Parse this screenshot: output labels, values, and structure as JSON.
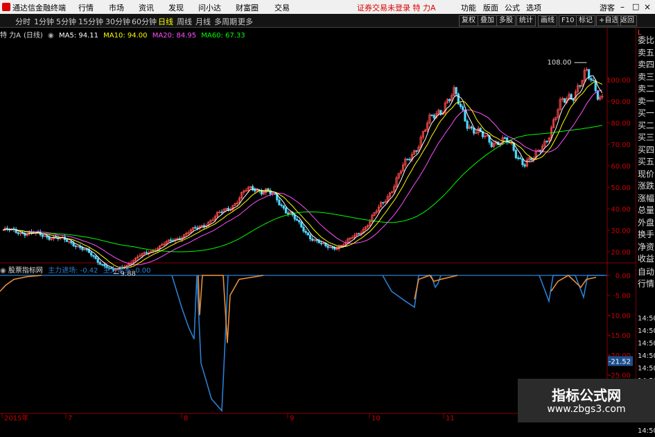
{
  "menubar": {
    "app_title": "通达信金融终端",
    "menus": [
      "行情",
      "市场",
      "资讯",
      "发现",
      "问小达",
      "财富圈",
      "交易"
    ],
    "notice": "证券交易未登录  特 力A",
    "right_menus": [
      "功能",
      "版面",
      "公式",
      "选项"
    ],
    "user": "游客"
  },
  "toolbar": {
    "periods": [
      "分时",
      "1分钟",
      "5分钟",
      "15分钟",
      "30分钟",
      "60分钟",
      "日线",
      "周线",
      "月线",
      "多周期",
      "更多"
    ],
    "active_period": "日线",
    "buttons": [
      "复权",
      "叠加",
      "多股",
      "统计",
      "画线",
      "F10",
      "标记",
      "+自选",
      "返回"
    ]
  },
  "info": {
    "stock": "特 力A",
    "period": "(日线)",
    "ma5": "MA5: 94.11",
    "ma10": "MA10: 94.00",
    "ma20": "MA20: 84.95",
    "ma60": "MA60: 67.33",
    "colors": {
      "ma5": "#ffffff",
      "ma10": "#ffff00",
      "ma20": "#ff50ff",
      "ma60": "#00ff00"
    }
  },
  "price_axis": {
    "ticks": [
      "100.00",
      "90.00",
      "80.00",
      "70.00",
      "60.00",
      "50.00",
      "40.00",
      "30.00",
      "20.00"
    ],
    "high_label": "108.00",
    "low_label": "9.88"
  },
  "sub_indicator": {
    "name": "股票指标网",
    "line1": "主力进场: -0.42",
    "line2": "主力诱多: 0.00",
    "ticks": [
      "0.00",
      "-5.00",
      "-10.00",
      "-15.00",
      "-20.00",
      "-25.00",
      "-30.00",
      "-35.00"
    ],
    "current": "-21.52",
    "colors": {
      "line1": "#2a7fd4",
      "line2": "#e8903a"
    }
  },
  "date_axis": [
    "2015年",
    "7",
    "8",
    "9",
    "10",
    "11"
  ],
  "side_tabs": [
    "委比",
    "卖五",
    "卖四",
    "卖三",
    "卖二",
    "卖一",
    "买一",
    "买二",
    "买三",
    "买四",
    "买五",
    "现价",
    "涨跌",
    "涨幅",
    "总量",
    "外盘",
    "换手",
    "净资",
    "收益",
    "自动",
    "行情"
  ],
  "side_times": [
    "14:50",
    "14:50",
    "14:50",
    "14:50",
    "14:50",
    "14:50",
    "14:50",
    "14:50",
    "14:50",
    "14:50"
  ],
  "watermark": {
    "line1": "指标公式网",
    "line2": "www.zbgs3.com"
  }
}
